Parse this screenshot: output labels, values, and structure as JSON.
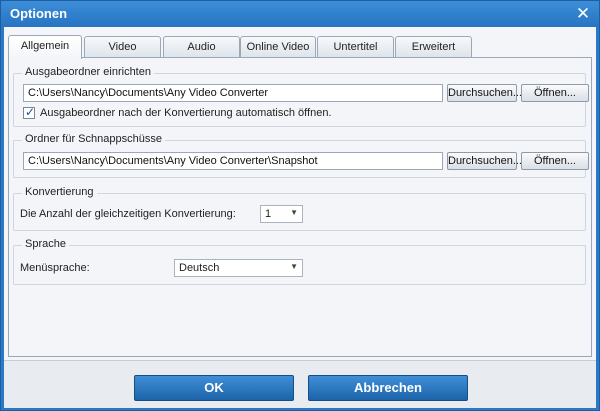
{
  "window": {
    "title": "Optionen"
  },
  "tabs": [
    {
      "label": "Allgemein"
    },
    {
      "label": "Video"
    },
    {
      "label": "Audio"
    },
    {
      "label": "Online Video"
    },
    {
      "label": "Untertitel"
    },
    {
      "label": "Erweitert"
    }
  ],
  "output_folder": {
    "title": "Ausgabeordner einrichten",
    "path": "C:\\Users\\Nancy\\Documents\\Any Video Converter",
    "browse_label": "Durchsuchen...",
    "open_label": "Öffnen...",
    "auto_open_label": "Ausgabeordner nach der Konvertierung automatisch öffnen.",
    "auto_open_checked": true
  },
  "snapshot_folder": {
    "title": "Ordner für Schnappschüsse",
    "path": "C:\\Users\\Nancy\\Documents\\Any Video Converter\\Snapshot",
    "browse_label": "Durchsuchen...",
    "open_label": "Öffnen..."
  },
  "conversion": {
    "title": "Konvertierung",
    "concurrent_label": "Die Anzahl der gleichzeitigen Konvertierung:",
    "concurrent_value": "1"
  },
  "language": {
    "title": "Sprache",
    "menu_language_label": "Menüsprache:",
    "menu_language_value": "Deutsch"
  },
  "footer": {
    "ok_label": "OK",
    "cancel_label": "Abbrechen"
  }
}
